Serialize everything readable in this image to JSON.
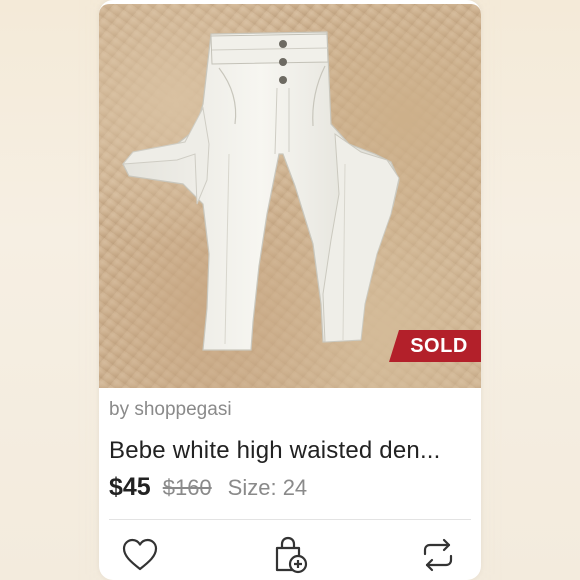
{
  "listing": {
    "badge": "SOLD",
    "seller": "by shoppegasi",
    "title": "Bebe white high waisted den...",
    "price": "$45",
    "original_price": "$160",
    "size": "Size: 24"
  },
  "actions": {
    "like_icon": "heart-icon",
    "bundle_icon": "bag-add-icon",
    "share_icon": "repeat-icon"
  },
  "colors": {
    "badge_bg": "#b3202a",
    "text_primary": "#222222",
    "text_secondary": "#8a8a8a"
  }
}
